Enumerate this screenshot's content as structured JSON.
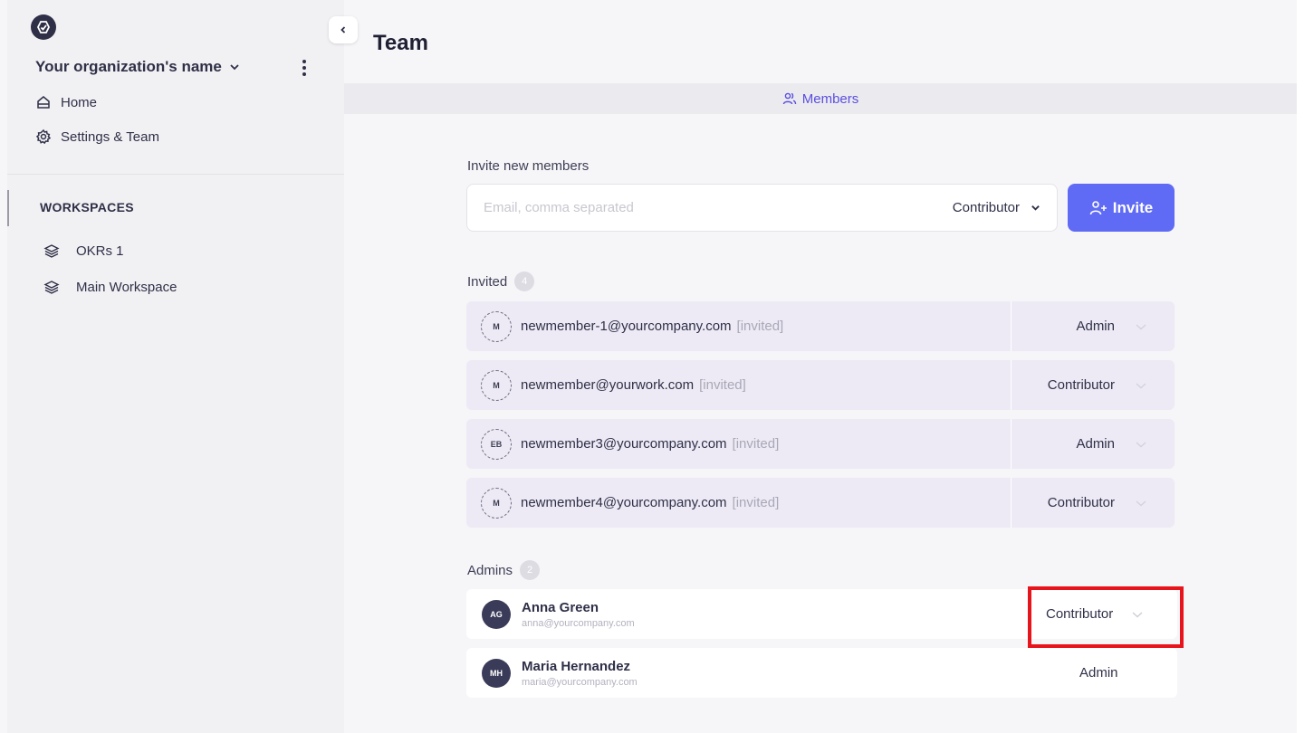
{
  "sidebar": {
    "org_name": "Your organization's name",
    "nav": [
      {
        "label": "Home",
        "icon": "home-icon"
      },
      {
        "label": "Settings & Team",
        "icon": "gear-icon"
      }
    ],
    "workspaces_heading": "WORKSPACES",
    "workspaces": [
      {
        "label": "OKRs 1",
        "icon": "layers-icon"
      },
      {
        "label": "Main Workspace",
        "icon": "layers-icon"
      }
    ]
  },
  "page": {
    "title": "Team",
    "tab_members": "Members"
  },
  "invite": {
    "label": "Invite new members",
    "placeholder": "Email, comma separated",
    "role": "Contributor",
    "button": "Invite"
  },
  "invited": {
    "label": "Invited",
    "count": "4",
    "rows": [
      {
        "initials": "M",
        "email": "newmember-1@yourcompany.com",
        "tag": "[invited]",
        "role": "Admin"
      },
      {
        "initials": "M",
        "email": "newmember@yourwork.com",
        "tag": "[invited]",
        "role": "Contributor"
      },
      {
        "initials": "EB",
        "email": "newmember3@yourcompany.com",
        "tag": "[invited]",
        "role": "Admin"
      },
      {
        "initials": "M",
        "email": "newmember4@yourcompany.com",
        "tag": "[invited]",
        "role": "Contributor"
      }
    ]
  },
  "admins": {
    "label": "Admins",
    "count": "2",
    "rows": [
      {
        "initials": "AG",
        "name": "Anna Green",
        "email": "anna@yourcompany.com",
        "role": "Contributor"
      },
      {
        "initials": "MH",
        "name": "Maria Hernandez",
        "email": "maria@yourcompany.com",
        "role": "Admin"
      }
    ]
  },
  "colors": {
    "accent": "#5f6bf4",
    "tab_active": "#5a4fe0",
    "invited_row": "#edeaf5",
    "highlight": "#e8141b"
  }
}
